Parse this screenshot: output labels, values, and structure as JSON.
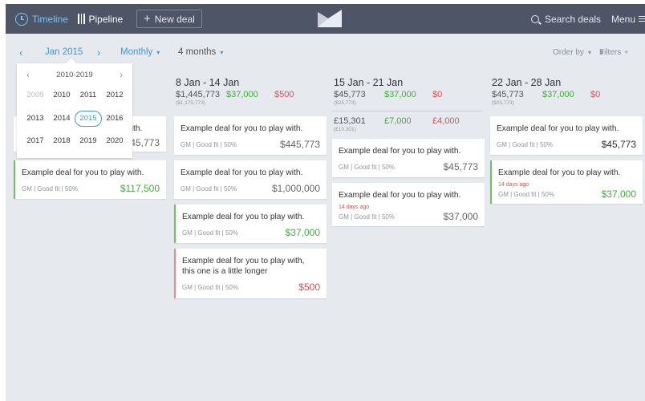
{
  "nav": {
    "timeline": "Timeline",
    "pipeline": "Pipeline",
    "new_deal": "New deal",
    "search": "Search deals",
    "menu": "Menu"
  },
  "toolbar": {
    "prev": "‹",
    "month": "Jan 2015",
    "next": "›",
    "period": "Monthly",
    "range": "4 months",
    "order": "Order by",
    "filters": "Filters"
  },
  "picker": {
    "title": "2010-2019",
    "prev": "‹",
    "next": "›",
    "years": [
      "2009",
      "2010",
      "2011",
      "2012",
      "2013",
      "2014",
      "2015",
      "2016",
      "2017",
      "2018",
      "2019",
      "2020"
    ],
    "selected": "2015"
  },
  "columns": [
    {
      "cards": [
        {
          "title": "Example deal for you to play with.",
          "value": "$45,773"
        },
        {
          "title": "Example deal for you to play with.",
          "meta": "GM | Good fit | 50%",
          "value": "$117,500"
        }
      ]
    },
    {
      "week": "8 Jan - 14 Jan",
      "total": "$1,445,773",
      "won": "$37,000",
      "lost": "$500",
      "sub": "($1,175,773)",
      "cards": [
        {
          "title": "Example deal for you to play with.",
          "meta": "GM | Good fit | 50%",
          "value": "$445,773"
        },
        {
          "title": "Example deal for you to play with.",
          "meta": "GM | Good fit | 50%",
          "value": "$1,000,000"
        },
        {
          "title": "Example deal for you to play with.",
          "meta": "GM | Good fit | 50%",
          "value": "$37,000"
        },
        {
          "title": "Example deal for you to play with, this one is a little longer",
          "meta": "GM | Good fit | 50%",
          "value": "$500"
        }
      ]
    },
    {
      "week": "15 Jan - 21 Jan",
      "total": "$45,773",
      "won": "$37,000",
      "lost": "$0",
      "sub": "($25,773)",
      "total2": "£15,301",
      "won2": "£7,000",
      "lost2": "£4,000",
      "sub2": "(£10,301)",
      "cards": [
        {
          "title": "Example deal for you to play with.",
          "meta": "GM | Good fit | 50%",
          "value": "$45,773"
        },
        {
          "title": "Example deal for you to play with.",
          "ago": "14 days ago",
          "meta": "GM | Good fit | 50%",
          "value": "$37,000"
        }
      ]
    },
    {
      "week": "22 Jan - 28 Jan",
      "total": "$45,773",
      "won": "$37,000",
      "lost": "$0",
      "sub": "($25,773)",
      "cards": [
        {
          "title": "Example deal for you to play with.",
          "meta": "GM | Good fit | 50%",
          "value": "$45,773"
        },
        {
          "title": "Example deal for you to play with.",
          "ago": "14 days ago",
          "meta": "GM | Good fit | 50%",
          "value": "$37,000"
        }
      ]
    }
  ]
}
